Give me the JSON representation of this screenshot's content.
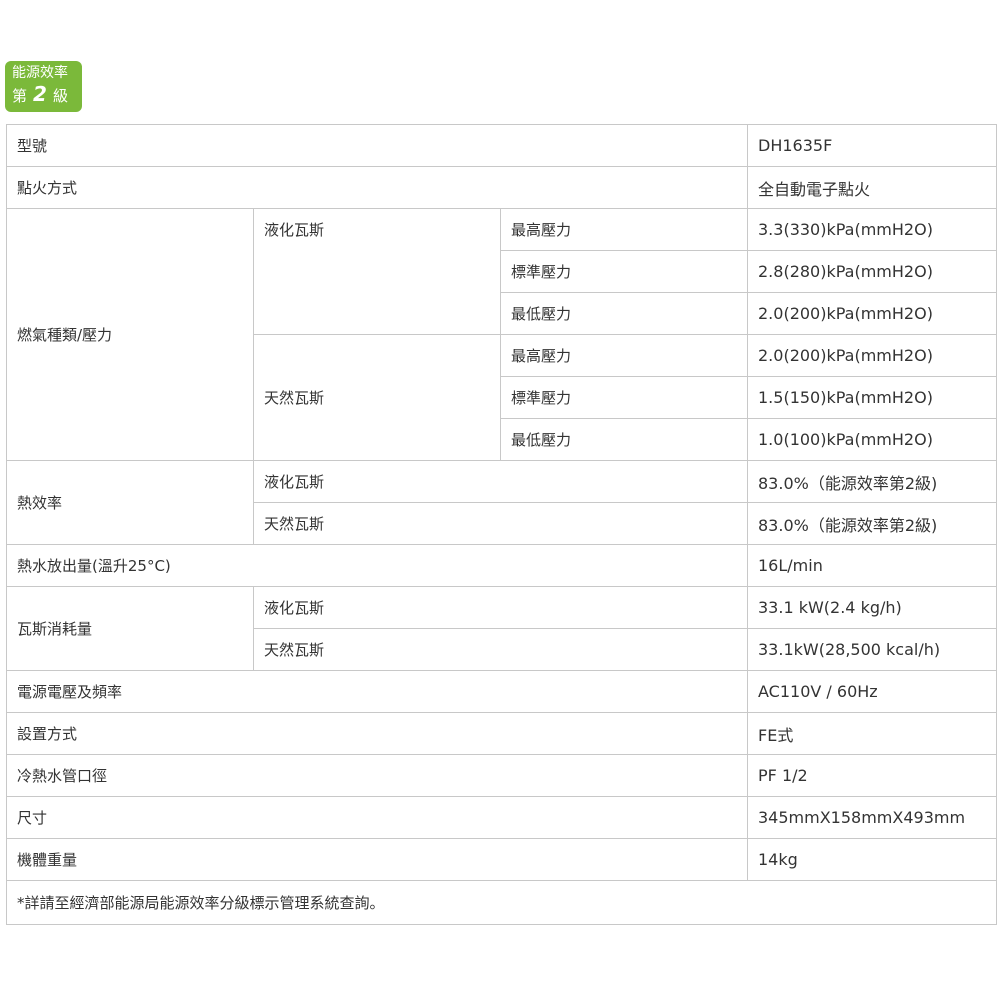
{
  "badge": {
    "line1": "能源效率",
    "prefix": "第",
    "number": "2",
    "suffix": "級"
  },
  "spec": {
    "model": {
      "label": "型號",
      "value": "DH1635F"
    },
    "ignition": {
      "label": "點火方式",
      "value": "全自動電子點火"
    },
    "gas_pressure": {
      "label": "燃氣種類/壓力",
      "lpg": {
        "label": "液化瓦斯",
        "max_label": "最高壓力",
        "max_value": "3.3(330)kPa(mmH2O)",
        "std_label": "標準壓力",
        "std_value": "2.8(280)kPa(mmH2O)",
        "min_label": "最低壓力",
        "min_value": "2.0(200)kPa(mmH2O)"
      },
      "ng": {
        "label": "天然瓦斯",
        "max_label": "最高壓力",
        "max_value": "2.0(200)kPa(mmH2O)",
        "std_label": "標準壓力",
        "std_value": "1.5(150)kPa(mmH2O)",
        "min_label": "最低壓力",
        "min_value": "1.0(100)kPa(mmH2O)"
      }
    },
    "efficiency": {
      "label": "熱效率",
      "lpg_label": "液化瓦斯",
      "lpg_value": "83.0%（能源效率第2級)",
      "ng_label": "天然瓦斯",
      "ng_value": "83.0%（能源效率第2級)"
    },
    "hot_water": {
      "label": "熱水放出量(溫升25°C)",
      "value": "16L/min"
    },
    "consumption": {
      "label": "瓦斯消耗量",
      "lpg_label": "液化瓦斯",
      "lpg_value": "33.1 kW(2.4 kg/h)",
      "ng_label": "天然瓦斯",
      "ng_value": "33.1kW(28,500 kcal/h)"
    },
    "power": {
      "label": "電源電壓及頻率",
      "value": "AC110V / 60Hz"
    },
    "install": {
      "label": "設置方式",
      "value": "FE式"
    },
    "pipe": {
      "label": "冷熱水管口徑",
      "value": "PF 1/2"
    },
    "size": {
      "label": "尺寸",
      "value": "345mmX158mmX493mm"
    },
    "weight": {
      "label": "機體重量",
      "value": "14kg"
    },
    "note": "*詳請至經濟部能源局能源效率分級標示管理系統查詢。"
  }
}
